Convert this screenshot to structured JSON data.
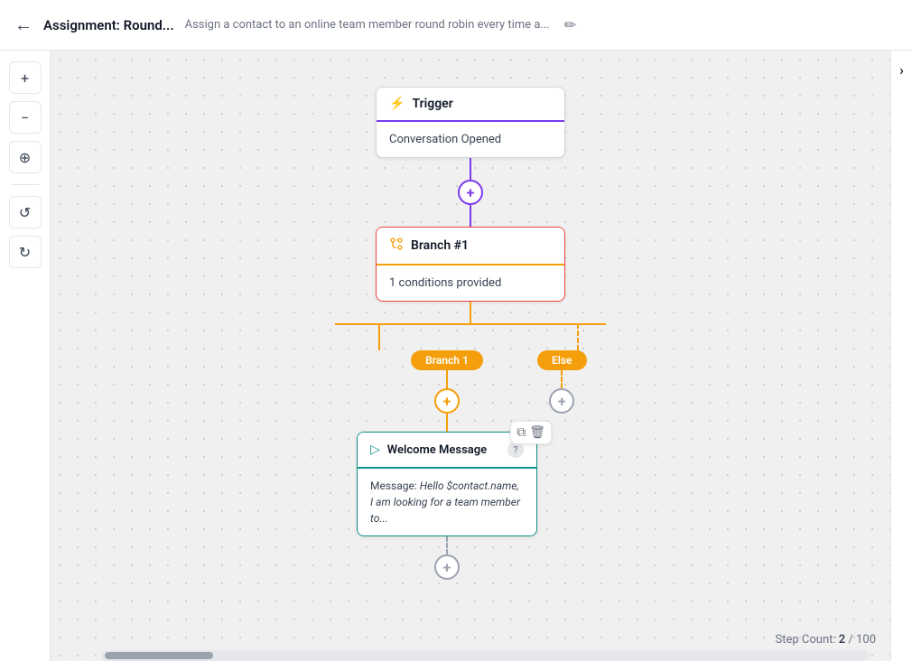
{
  "header": {
    "back_label": "←",
    "title": "Assignment: Round...",
    "description": "Assign a contact to an online team member round robin every time a...",
    "edit_icon": "✏"
  },
  "toolbar": {
    "zoom_in": "+",
    "zoom_out": "−",
    "center": "⊕",
    "undo": "↺",
    "redo": "↻"
  },
  "trigger_node": {
    "icon": "⚡",
    "title": "Trigger",
    "body": "Conversation Opened"
  },
  "branch_node": {
    "icon": "🔀",
    "title": "Branch #1",
    "body": "1 conditions provided"
  },
  "branch_labels": {
    "branch1": "Branch 1",
    "else": "Else"
  },
  "message_node": {
    "icon": "▷",
    "title": "Welcome Message",
    "help": "?",
    "body_label": "Message:",
    "body_text": "Hello $contact.name, I am looking for a team member to..."
  },
  "step_count": {
    "label": "Step Count:",
    "current": "2",
    "max": "100",
    "separator": "/"
  },
  "add_buttons": {
    "symbol": "+"
  },
  "panel_toggle": "›",
  "node_actions": {
    "copy": "⧉",
    "delete": "🗑"
  }
}
